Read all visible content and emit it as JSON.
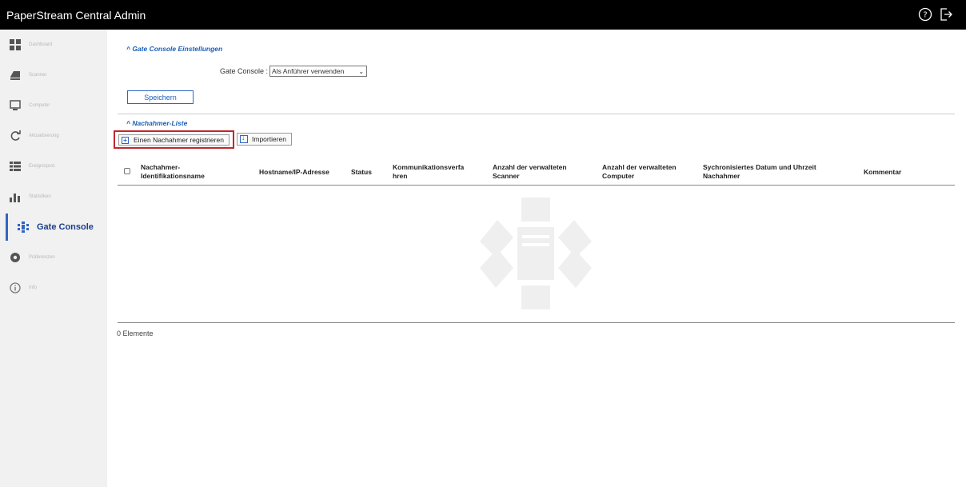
{
  "app": {
    "title": "PaperStream Central Admin"
  },
  "topbar": {
    "help_icon": "help-circle-icon",
    "logout_icon": "logout-icon"
  },
  "sidebar": {
    "items": [
      {
        "label": "Dashboard",
        "icon": "dashboard-icon"
      },
      {
        "label": "Scanner",
        "icon": "scanner-icon"
      },
      {
        "label": "Computer",
        "icon": "computer-icon"
      },
      {
        "label": "Aktualisierung",
        "icon": "refresh-icon"
      },
      {
        "label": "Ereignisprot.",
        "icon": "event-log-icon"
      },
      {
        "label": "Statistiken",
        "icon": "statistics-icon"
      },
      {
        "label": "Gate Console",
        "icon": "gate-console-icon"
      },
      {
        "label": "Präferenzen",
        "icon": "gear-icon"
      },
      {
        "label": "Info",
        "icon": "info-icon"
      }
    ],
    "active_index": 6
  },
  "settings_section": {
    "title": "^ Gate Console Einstellungen",
    "gate_console_label": "Gate Console :",
    "gate_console_value": "Als Anführer verwenden",
    "save_label": "Speichern"
  },
  "follower_section": {
    "title": "^ Nachahmer-Liste",
    "register_label": "Einen Nachahmer registrieren",
    "import_label": "Importieren",
    "columns": [
      "Nachahmer-\nIdentifikationsname",
      "Hostname/IP-Adresse",
      "Status",
      "Kommunikationsverfa\nhren",
      "Anzahl der verwalteten\nScanner",
      "Anzahl der verwalteten\nComputer",
      "Sychronisiertes Datum und Uhrzeit\nNachahmer",
      "Kommentar"
    ],
    "rows": [],
    "count_label": "0 Elemente"
  },
  "colors": {
    "accent": "#2f66c4",
    "highlight_border": "#c0282c",
    "topbar": "#000000",
    "sidebar": "#f1f1f1"
  }
}
